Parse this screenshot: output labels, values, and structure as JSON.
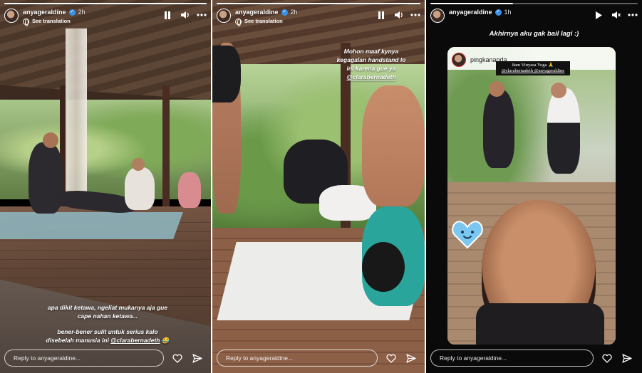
{
  "stories": [
    {
      "username": "anyageraldine",
      "time": "2h",
      "see_translation": "See translation",
      "caption_lines": [
        "apa dikit ketawa, ngeliat mukanya aja gue",
        "cape nahan ketawa...",
        "",
        "bener-bener sulit untuk serius kalo",
        "disebelah manusia ini"
      ],
      "caption_mention": "@clarabernadeth",
      "caption_emoji": "😂",
      "reply_placeholder": "Reply to anyageraldine..."
    },
    {
      "username": "anyageraldine",
      "time": "2h",
      "see_translation": "See translation",
      "caption_lines": [
        "Mohon maaf kynya",
        "kegagalan handstand lo",
        "ini karena gue ya"
      ],
      "caption_mention": "@clarabernadeth",
      "reply_placeholder": "Reply to anyageraldine..."
    },
    {
      "username": "anyageraldine",
      "time": "1h",
      "title": "Akhirnya aku gak bail lagi :)",
      "shared_post_user": "pingkananda",
      "shared_post_tag_lines": [
        "8am Vinyasa Yoga 🙏",
        "@clarabernadeth @anyageraldine"
      ],
      "reply_placeholder": "Reply to anyageraldine..."
    }
  ],
  "icons": {
    "pause": "pause-icon",
    "play": "play-icon",
    "volume": "speaker-icon",
    "mute": "speaker-muted-icon",
    "more": "more-icon",
    "heart": "heart-icon",
    "send": "send-icon",
    "verified": "verified-badge-icon"
  }
}
